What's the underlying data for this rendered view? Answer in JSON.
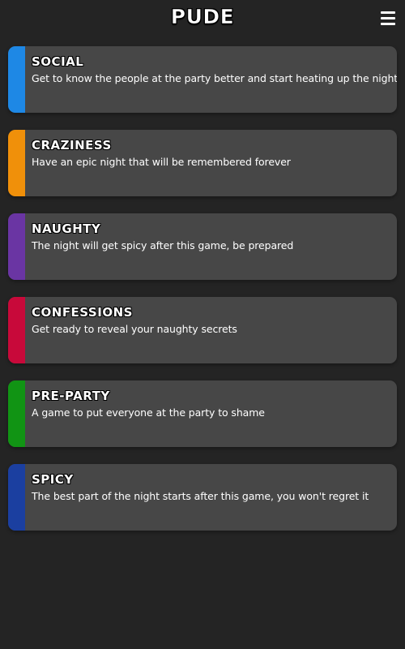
{
  "app": {
    "title": "PUDE",
    "menu_icon": "hamburger-menu-icon"
  },
  "categories": [
    {
      "title": "SOCIAL",
      "description": "Get to know the people at the party better and start heating up the night",
      "color": "#1E88E5"
    },
    {
      "title": "CRAZINESS",
      "description": "Have an epic night that will be remembered forever",
      "color": "#F0900A"
    },
    {
      "title": "NAUGHTY",
      "description": "The night will get spicy after this game, be prepared",
      "color": "#6A35A3"
    },
    {
      "title": "CONFESSIONS",
      "description": "Get ready to reveal your naughty secrets",
      "color": "#C8093A"
    },
    {
      "title": "PRE-PARTY",
      "description": "A game to put everyone at the party to shame",
      "color": "#119414"
    },
    {
      "title": "SPICY",
      "description": "The best part of the night starts after this game, you won't regret it",
      "color": "#1B3FA0"
    }
  ]
}
